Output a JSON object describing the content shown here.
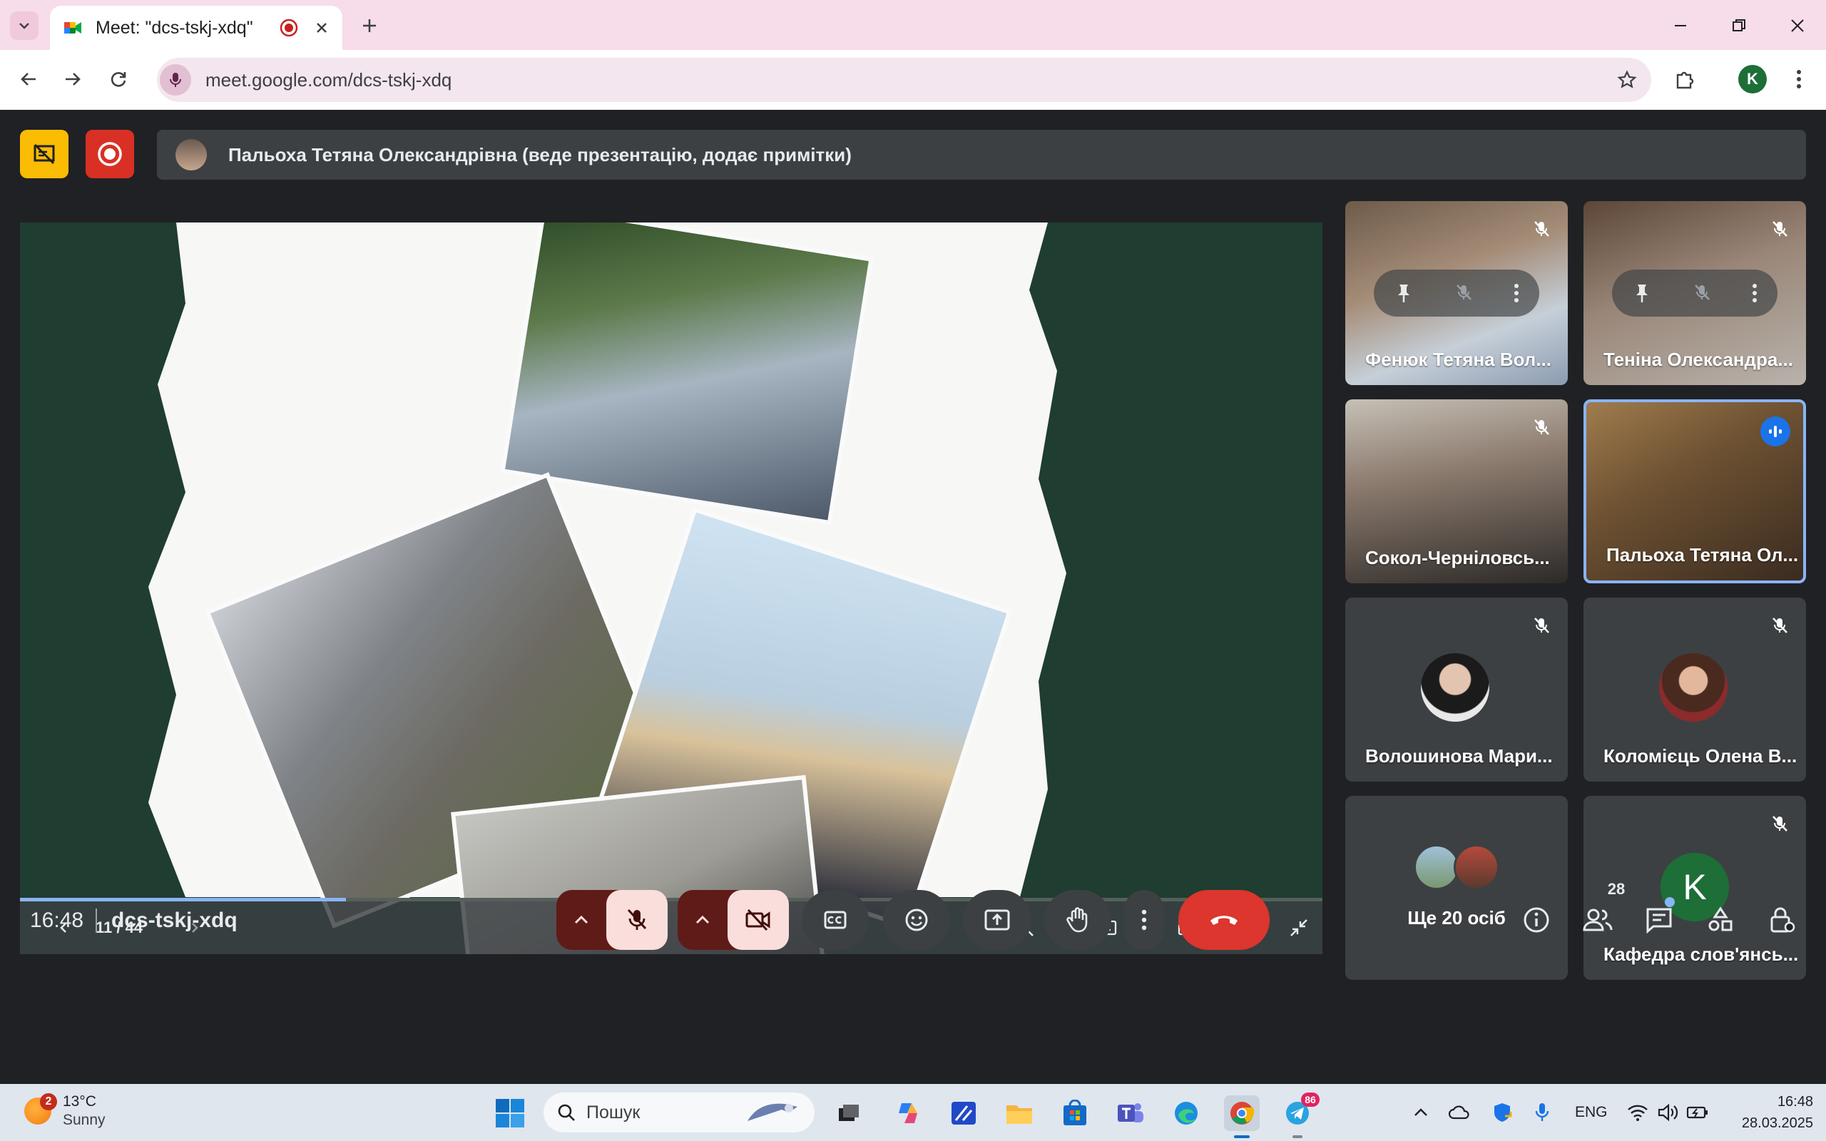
{
  "browser": {
    "tab_title": "Meet: \"dcs-tskj-xdq\"",
    "url": "meet.google.com/dcs-tskj-xdq",
    "profile_initial": "K"
  },
  "meet": {
    "presenter_banner": "Пальоха Тетяна Олександрівна (веде презентацію, додає примітки)",
    "slide": {
      "counter": "11 / 44",
      "progress": 0.25
    },
    "participants": [
      {
        "name": "Фенюк Тетяна Вол...",
        "muted": true
      },
      {
        "name": "Теніна Олександра...",
        "muted": true
      },
      {
        "name": "Сокол-Черніловсь...",
        "muted": true
      },
      {
        "name": "Пальоха Тетяна Ол...",
        "speaking": true
      },
      {
        "name": "Волошинова Мари...",
        "muted": true
      },
      {
        "name": "Коломієць Олена В...",
        "muted": true
      },
      {
        "name": "Ще 20 осіб"
      },
      {
        "name": "Кафедра слов'янсь...",
        "muted": true,
        "initial": "K"
      }
    ],
    "clock": "16:48",
    "meeting_code": "dcs-tskj-xdq",
    "people_count": "28"
  },
  "taskbar": {
    "weather_temp": "13°C",
    "weather_cond": "Sunny",
    "weather_badge": "2",
    "search_placeholder": "Пошук",
    "telegram_badge": "86",
    "language": "ENG",
    "time": "16:48",
    "date": "28.03.2025"
  },
  "colors": {
    "tab_strip": "#f7dcea",
    "meet_bg": "#202124",
    "tile_bg": "#3c4043",
    "active_border": "#8ab4f8",
    "end_call": "#dc362e",
    "muted_btn": "#f9dedc",
    "avatar_green": "#1e6e37"
  }
}
